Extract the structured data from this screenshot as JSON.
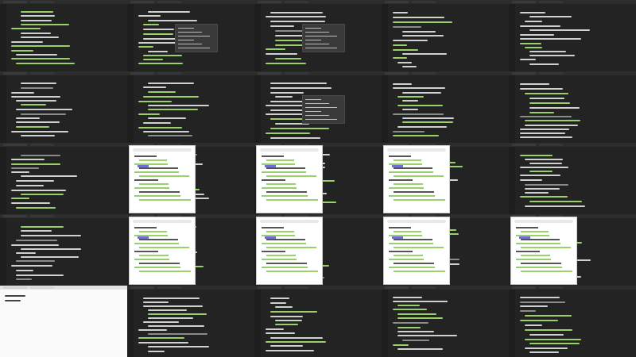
{
  "grid": {
    "rows": 5,
    "cols": 5
  },
  "colors": {
    "editor_bg": "#232323",
    "code_keyword": "#d0d0d0",
    "code_string": "#9bcf6a",
    "code_comment": "#8b8b8b",
    "menu_bg": "#3a3a3a",
    "browser_bg": "#ffffff",
    "selection": "#6f6fd6"
  },
  "tiles": [
    {
      "kind": "editor",
      "menu": false,
      "browser": false
    },
    {
      "kind": "editor",
      "menu": true,
      "browser": false
    },
    {
      "kind": "editor",
      "menu": true,
      "browser": false
    },
    {
      "kind": "editor",
      "menu": false,
      "browser": false
    },
    {
      "kind": "editor",
      "menu": false,
      "browser": false
    },
    {
      "kind": "editor",
      "menu": false,
      "browser": false
    },
    {
      "kind": "editor",
      "menu": false,
      "browser": false
    },
    {
      "kind": "editor",
      "menu": true,
      "browser": false
    },
    {
      "kind": "editor",
      "menu": false,
      "browser": false
    },
    {
      "kind": "editor",
      "menu": false,
      "browser": false
    },
    {
      "kind": "editor",
      "menu": false,
      "browser": false
    },
    {
      "kind": "editor",
      "menu": false,
      "browser": true
    },
    {
      "kind": "editor",
      "menu": false,
      "browser": true
    },
    {
      "kind": "editor",
      "menu": false,
      "browser": true
    },
    {
      "kind": "editor",
      "menu": false,
      "browser": false
    },
    {
      "kind": "editor",
      "menu": false,
      "browser": false
    },
    {
      "kind": "editor",
      "menu": false,
      "browser": true
    },
    {
      "kind": "editor",
      "menu": false,
      "browser": true
    },
    {
      "kind": "editor",
      "menu": false,
      "browser": true
    },
    {
      "kind": "editor",
      "menu": false,
      "browser": true
    },
    {
      "kind": "light",
      "menu": false,
      "browser": false
    },
    {
      "kind": "editor",
      "menu": false,
      "browser": false
    },
    {
      "kind": "editor",
      "menu": false,
      "browser": false
    },
    {
      "kind": "editor",
      "menu": false,
      "browser": false
    },
    {
      "kind": "editor",
      "menu": false,
      "browser": false
    }
  ]
}
